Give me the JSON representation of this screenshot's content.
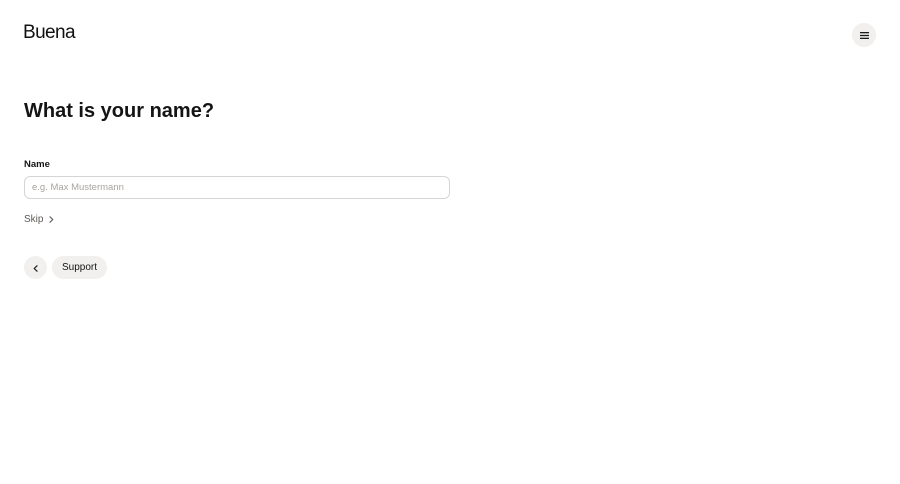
{
  "header": {
    "logo_text": "Buena",
    "menu_icon": "hamburger-menu-icon"
  },
  "main": {
    "title": "What is your name?",
    "name_field": {
      "label": "Name",
      "value": "",
      "placeholder": "e.g. Max Mustermann"
    },
    "skip_label": "Skip",
    "skip_icon": "chevron-right-icon",
    "back_icon": "chevron-left-icon",
    "support_label": "Support"
  }
}
